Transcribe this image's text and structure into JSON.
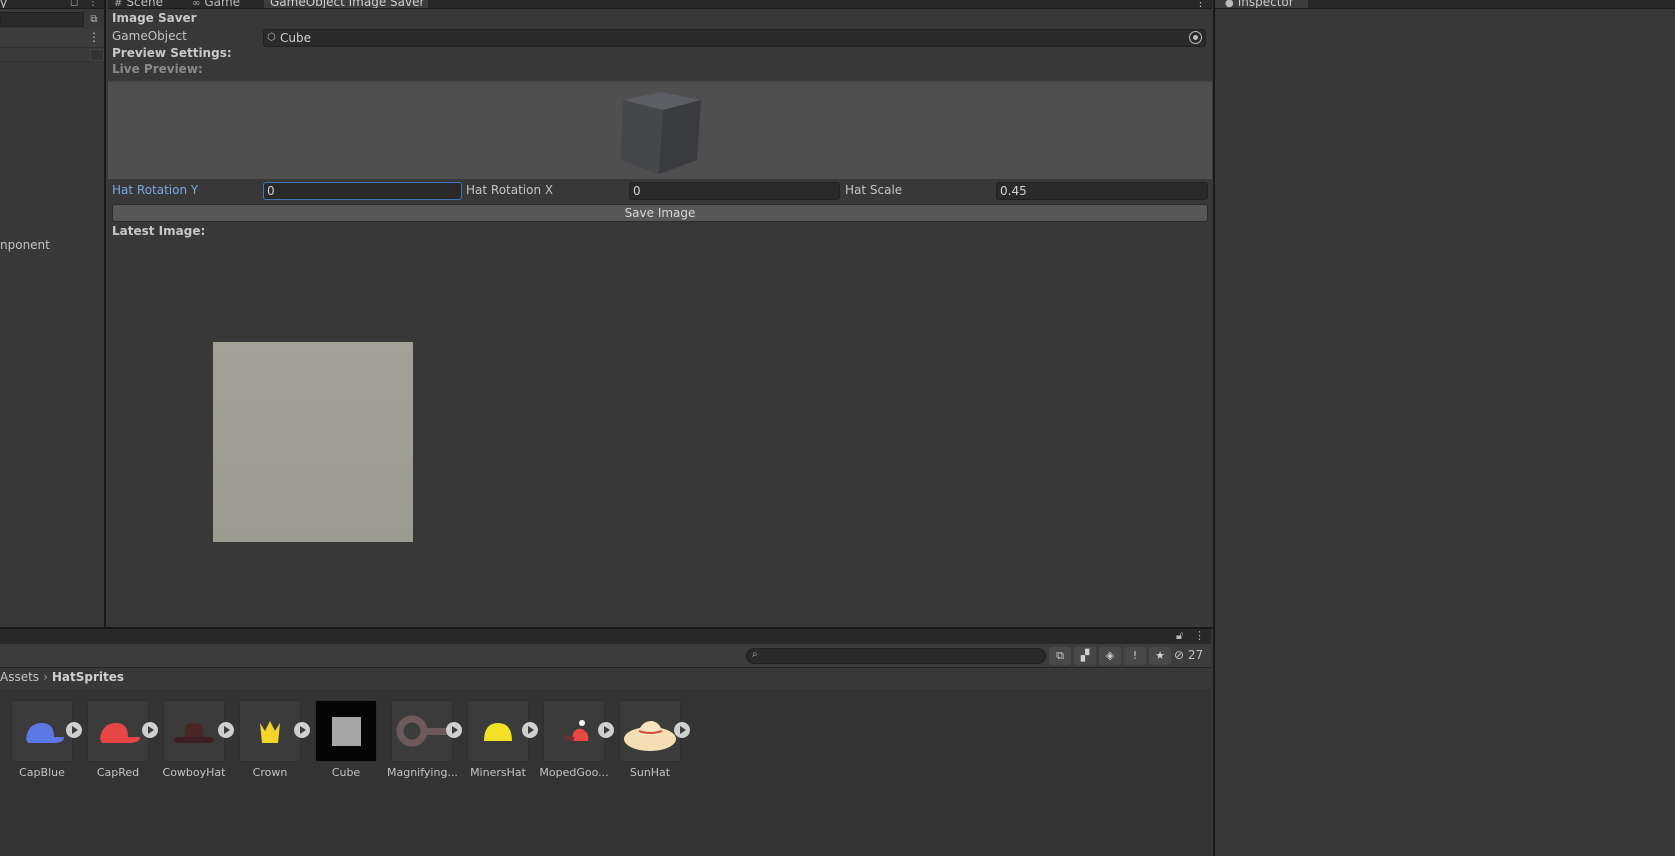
{
  "hierarchy": {
    "title_fragment": "y",
    "component_fragment": "nponent"
  },
  "tabs": [
    {
      "label": "Scene",
      "icon": "scene-grid-icon"
    },
    {
      "label": "Game",
      "icon": "game-controller-icon"
    },
    {
      "label": "GameObject Image Saver",
      "icon": ""
    }
  ],
  "editor": {
    "header": "Image Saver",
    "gameobject_label": "GameObject",
    "gameobject_value": "Cube",
    "preview_settings_label": "Preview Settings:",
    "live_preview_label": "Live Preview:",
    "fields": [
      {
        "label": "Hat Rotation Y",
        "value": "0"
      },
      {
        "label": "Hat Rotation X",
        "value": "0"
      },
      {
        "label": "Hat Scale",
        "value": "0.45"
      }
    ],
    "save_button": "Save Image",
    "latest_image_label": "Latest Image:"
  },
  "inspector": {
    "tab_label": "Inspector"
  },
  "project": {
    "search_placeholder": "",
    "hidden_count": "27",
    "breadcrumb": [
      "Assets",
      "HatSprites"
    ],
    "assets": [
      {
        "name": "CapBlue"
      },
      {
        "name": "CapRed"
      },
      {
        "name": "CowboyHat"
      },
      {
        "name": "Crown"
      },
      {
        "name": "Cube"
      },
      {
        "name": "Magnifying..."
      },
      {
        "name": "MinersHat"
      },
      {
        "name": "MopedGoo..."
      },
      {
        "name": "SunHat"
      }
    ]
  },
  "colors": {
    "panel_bg": "#383838",
    "tab_bar_bg": "#282828",
    "field_bg": "#2a2a2a",
    "focus_blue": "#3a79bb",
    "focused_label": "#7ba7e0",
    "preview_bg": "#4f4f4f",
    "cap_blue": "#5c79e6",
    "cap_red": "#e84545",
    "cowboy_hat": "#4a2626",
    "crown": "#f2d42a",
    "miners_hat": "#f2e126"
  }
}
